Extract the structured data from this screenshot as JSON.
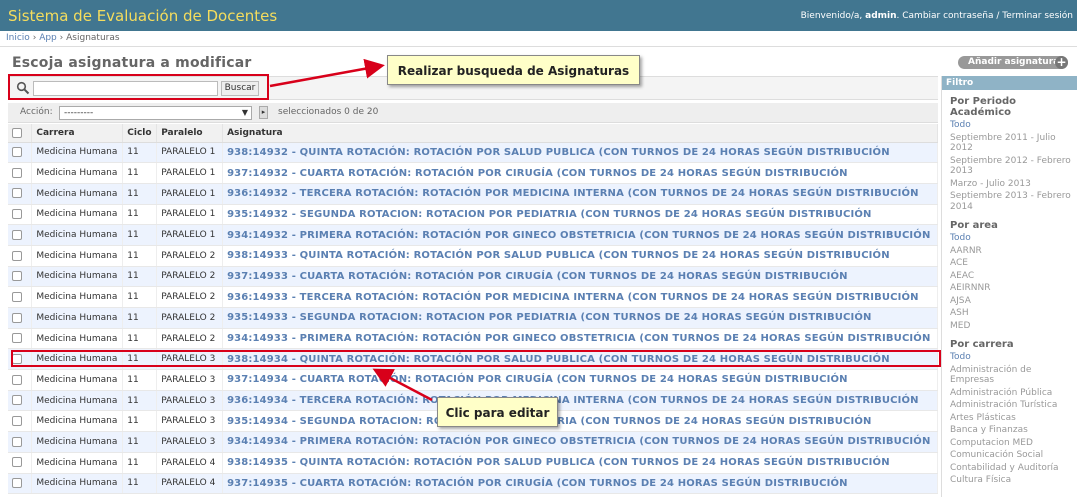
{
  "header": {
    "brand": "Sistema de Evaluación de Docentes",
    "welcome": "Bienvenido/a,",
    "username": "admin",
    "change_password": "Cambiar contraseña",
    "separator": "/",
    "logout": "Terminar sesión"
  },
  "breadcrumbs": {
    "home": "Inicio",
    "app": "App",
    "current": "Asignaturas",
    "sep": "›"
  },
  "page": {
    "title": "Escoja asignatura a modificar",
    "add_button": "Añadir asignatura",
    "add_icon": "+"
  },
  "search": {
    "placeholder": "",
    "button": "Buscar"
  },
  "actions": {
    "label": "Acción:",
    "selected": "---------",
    "go": "Ir",
    "count": "seleccionados 0 de 20"
  },
  "table": {
    "headers": [
      "Carrera",
      "Ciclo",
      "Paralelo",
      "Asignatura"
    ],
    "rows": [
      [
        "Medicina Humana",
        "11",
        "PARALELO 1",
        "938:14932 - QUINTA ROTACIÓN: ROTACIÓN POR SALUD PUBLICA (CON TURNOS DE 24 HORAS SEGÚN DISTRIBUCIÓN"
      ],
      [
        "Medicina Humana",
        "11",
        "PARALELO 1",
        "937:14932 - CUARTA ROTACIÓN: ROTACIÓN POR CIRUGÍA (CON TURNOS DE 24 HORAS SEGÚN DISTRIBUCIÓN"
      ],
      [
        "Medicina Humana",
        "11",
        "PARALELO 1",
        "936:14932 - TERCERA ROTACIÓN: ROTACIÓN POR MEDICINA INTERNA (CON TURNOS DE 24 HORAS SEGÚN DISTRIBUCIÓN"
      ],
      [
        "Medicina Humana",
        "11",
        "PARALELO 1",
        "935:14932 - SEGUNDA ROTACION: ROTACION POR PEDIATRIA (CON TURNOS DE 24 HORAS SEGÚN DISTRIBUCIÓN"
      ],
      [
        "Medicina Humana",
        "11",
        "PARALELO 1",
        "934:14932 - PRIMERA ROTACIÓN: ROTACIÓN POR GINECO OBSTETRICIA (CON TURNOS DE 24 HORAS SEGÚN DISTRIBUCIÓN"
      ],
      [
        "Medicina Humana",
        "11",
        "PARALELO 2",
        "938:14933 - QUINTA ROTACIÓN: ROTACIÓN POR SALUD PUBLICA (CON TURNOS DE 24 HORAS SEGÚN DISTRIBUCIÓN"
      ],
      [
        "Medicina Humana",
        "11",
        "PARALELO 2",
        "937:14933 - CUARTA ROTACIÓN: ROTACIÓN POR CIRUGÍA (CON TURNOS DE 24 HORAS SEGÚN DISTRIBUCIÓN"
      ],
      [
        "Medicina Humana",
        "11",
        "PARALELO 2",
        "936:14933 - TERCERA ROTACIÓN: ROTACIÓN POR MEDICINA INTERNA (CON TURNOS DE 24 HORAS SEGÚN DISTRIBUCIÓN"
      ],
      [
        "Medicina Humana",
        "11",
        "PARALELO 2",
        "935:14933 - SEGUNDA ROTACION: ROTACION POR PEDIATRIA (CON TURNOS DE 24 HORAS SEGÚN DISTRIBUCIÓN"
      ],
      [
        "Medicina Humana",
        "11",
        "PARALELO 2",
        "934:14933 - PRIMERA ROTACIÓN: ROTACIÓN POR GINECO OBSTETRICIA (CON TURNOS DE 24 HORAS SEGÚN DISTRIBUCIÓN"
      ],
      [
        "Medicina Humana",
        "11",
        "PARALELO 3",
        "938:14934 - QUINTA ROTACIÓN: ROTACIÓN POR SALUD PUBLICA (CON TURNOS DE 24 HORAS SEGÚN DISTRIBUCIÓN"
      ],
      [
        "Medicina Humana",
        "11",
        "PARALELO 3",
        "937:14934 - CUARTA ROTACIÓN: ROTACIÓN POR CIRUGÍA (CON TURNOS DE 24 HORAS SEGÚN DISTRIBUCIÓN"
      ],
      [
        "Medicina Humana",
        "11",
        "PARALELO 3",
        "936:14934 - TERCERA ROTACIÓN: ROTACIÓN POR MEDICINA INTERNA (CON TURNOS DE 24 HORAS SEGÚN DISTRIBUCIÓN"
      ],
      [
        "Medicina Humana",
        "11",
        "PARALELO 3",
        "935:14934 - SEGUNDA ROTACION: ROTACION POR PEDIATRIA (CON TURNOS DE 24 HORAS SEGÚN DISTRIBUCIÓN"
      ],
      [
        "Medicina Humana",
        "11",
        "PARALELO 3",
        "934:14934 - PRIMERA ROTACIÓN: ROTACIÓN POR GINECO OBSTETRICIA (CON TURNOS DE 24 HORAS SEGÚN DISTRIBUCIÓN"
      ],
      [
        "Medicina Humana",
        "11",
        "PARALELO 4",
        "938:14935 - QUINTA ROTACIÓN: ROTACIÓN POR SALUD PUBLICA (CON TURNOS DE 24 HORAS SEGÚN DISTRIBUCIÓN"
      ],
      [
        "Medicina Humana",
        "11",
        "PARALELO 4",
        "937:14935 - CUARTA ROTACIÓN: ROTACIÓN POR CIRUGÍA (CON TURNOS DE 24 HORAS SEGÚN DISTRIBUCIÓN"
      ]
    ]
  },
  "sidebar": {
    "title": "Filtro",
    "groups": [
      {
        "heading": "Por Periodo Académico",
        "items": [
          "Todo",
          "Septiembre 2011 - Julio 2012",
          "Septiembre 2012 - Febrero 2013",
          "Marzo - Julio 2013",
          "Septiembre 2013 - Febrero 2014"
        ]
      },
      {
        "heading": "Por area",
        "items": [
          "Todo",
          "AARNR",
          "ACE",
          "AEAC",
          "AEIRNNR",
          "AJSA",
          "ASH",
          "MED"
        ]
      },
      {
        "heading": "Por carrera",
        "items": [
          "Todo",
          "Administración de Empresas",
          "Administración Pública",
          "Administración Turística",
          "Artes Plásticas",
          "Banca y Finanzas",
          "Computacion MED",
          "Comunicación Social",
          "Contabilidad y Auditoría",
          "Cultura Física"
        ]
      }
    ]
  },
  "annotations": {
    "search_callout": "Realizar busqueda de Asignaturas",
    "edit_callout": "Clic para editar"
  },
  "colors": {
    "header_bg": "#417690",
    "brand": "#f5dd5d",
    "link": "#5b80b2",
    "highlight": "#d8001a",
    "callout_bg": "#ffffc8"
  }
}
